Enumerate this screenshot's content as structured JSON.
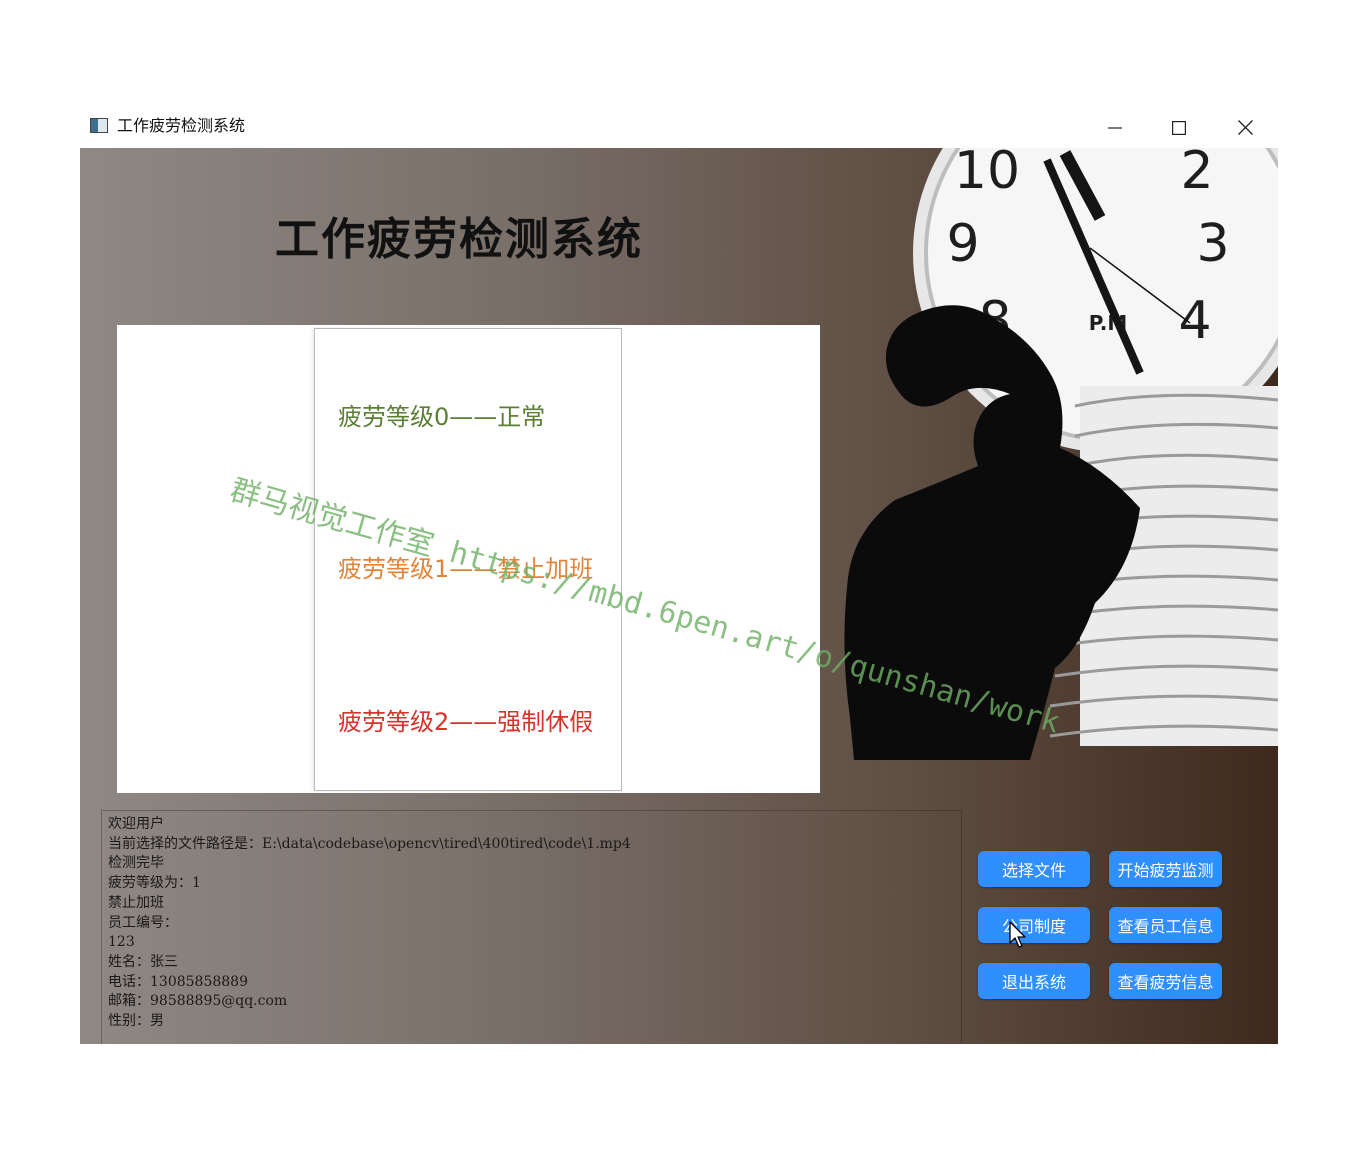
{
  "window": {
    "title": "工作疲劳检测系统",
    "controls": [
      "minimize-icon",
      "maximize-icon",
      "close-icon"
    ]
  },
  "app": {
    "title": "工作疲劳检测系统"
  },
  "legend": {
    "levels": [
      {
        "label": "疲劳等级0——正常",
        "color": "#5a7f35"
      },
      {
        "label": "疲劳等级1——禁止加班",
        "color": "#e2843a"
      },
      {
        "label": "疲劳等级2——强制休假",
        "color": "#d6332a"
      }
    ]
  },
  "log": {
    "lines": [
      "欢迎用户",
      "当前选择的文件路径是：E:\\data\\codebase\\opencv\\tired\\400tired\\code\\1.mp4",
      "检测完毕",
      "疲劳等级为：1",
      "禁止加班",
      "员工编号：",
      "123",
      "姓名：张三",
      "电话：13085858889",
      "邮箱：98588895@qq.com",
      "性别：男"
    ]
  },
  "buttons": {
    "select_file": "选择文件",
    "start_detection": "开始疲劳监测",
    "company_policy": "公司制度",
    "view_employee": "查看员工信息",
    "exit": "退出系统",
    "view_fatigue": "查看疲劳信息",
    "color": "#2f8fff"
  },
  "watermark": "群马视觉工作室 https://mbd.6pen.art/o/qunshan/work"
}
